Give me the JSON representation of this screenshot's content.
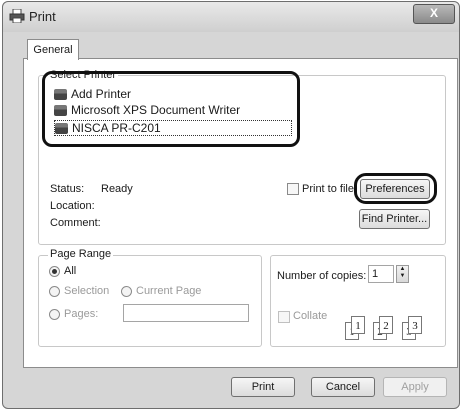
{
  "window": {
    "title": "Print",
    "close_label": "X"
  },
  "tabs": [
    {
      "label": "General"
    }
  ],
  "select_printer": {
    "legend": "Select Printer",
    "printers": [
      {
        "name": "Add Printer",
        "icon": "add-printer-icon"
      },
      {
        "name": "Microsoft XPS Document Writer",
        "icon": "printer-icon"
      },
      {
        "name": "NISCA PR-C201",
        "icon": "printer-icon",
        "selected": true
      }
    ]
  },
  "status": {
    "status_label": "Status:",
    "status_value": "Ready",
    "location_label": "Location:",
    "comment_label": "Comment:"
  },
  "print_to_file": {
    "label": "Print to file",
    "checked": false
  },
  "buttons": {
    "preferences": "Preferences",
    "find_printer": "Find Printer...",
    "print": "Print",
    "cancel": "Cancel",
    "apply": "Apply"
  },
  "page_range": {
    "legend": "Page Range",
    "all": "All",
    "selection": "Selection",
    "current_page": "Current Page",
    "pages": "Pages:",
    "pages_value": ""
  },
  "copies": {
    "label": "Number of copies:",
    "value": "1",
    "collate_label": "Collate",
    "collate_checked": false,
    "collate_pages": [
      "1",
      "1",
      "2",
      "2",
      "3",
      "3"
    ]
  }
}
